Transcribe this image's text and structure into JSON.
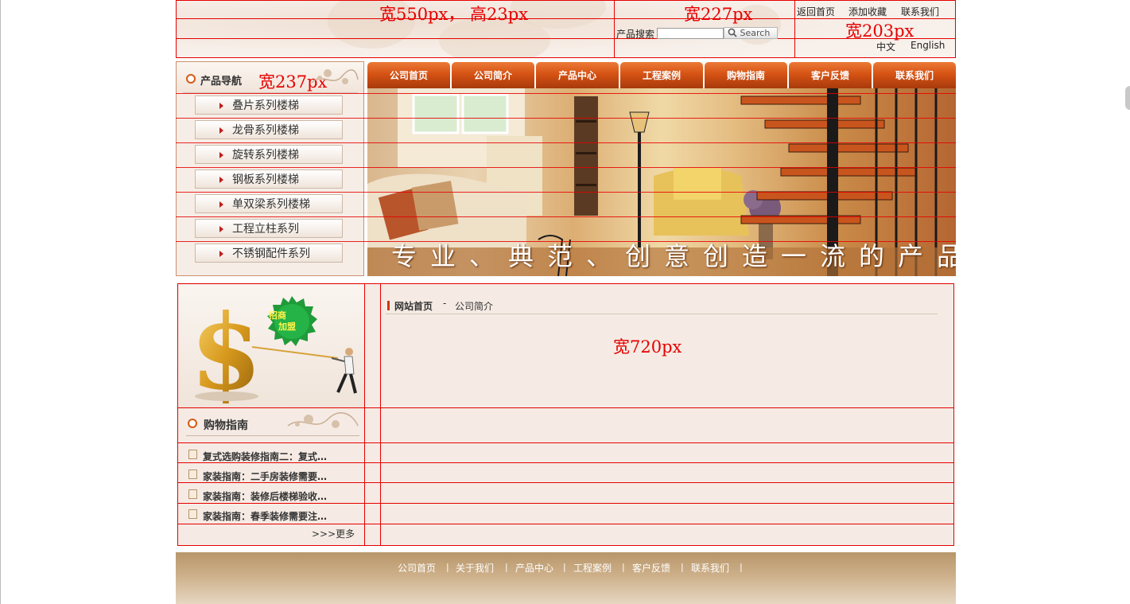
{
  "annotations": {
    "header_left": "宽550px， 高23px",
    "header_mid": "宽227px",
    "header_right": "宽203px",
    "nav_width": "宽237px",
    "content_width": "宽720px"
  },
  "search": {
    "label": "产品搜索",
    "value": "",
    "button": "Search"
  },
  "top_links": [
    "返回首页",
    "添加收藏",
    "联系我们"
  ],
  "languages": [
    "中文",
    "English"
  ],
  "product_nav": {
    "title": "产品导航",
    "items": [
      "叠片系列楼梯",
      "龙骨系列楼梯",
      "旋转系列楼梯",
      "钢板系列楼梯",
      "单双梁系列楼梯",
      "工程立柱系列",
      "不锈钢配件系列"
    ]
  },
  "menu": [
    "公司首页",
    "公司简介",
    "产品中心",
    "工程案例",
    "购物指南",
    "客户反馈",
    "联系我们"
  ],
  "banner": {
    "text": "专业、典范、创意创造一流的产品"
  },
  "promo": {
    "badge": [
      "招商",
      "加盟"
    ]
  },
  "shopping_guide": {
    "title": "购物指南",
    "items": [
      "复式选购装修指南二：复式…",
      "家装指南：二手房装修需要…",
      "家装指南：装修后楼梯验收…",
      "家装指南：春季装修需要注…"
    ],
    "more": ">>>更多"
  },
  "breadcrumb": {
    "home": "网站首页",
    "separator": "-",
    "current": "公司简介"
  },
  "footer": {
    "links": [
      "公司首页",
      "关于我们",
      "产品中心",
      "工程案例",
      "客户反馈",
      "联系我们"
    ]
  },
  "colors": {
    "accent": "#d65314",
    "annotation_red": "#e60000",
    "page_bg": "#f5ebe4"
  }
}
